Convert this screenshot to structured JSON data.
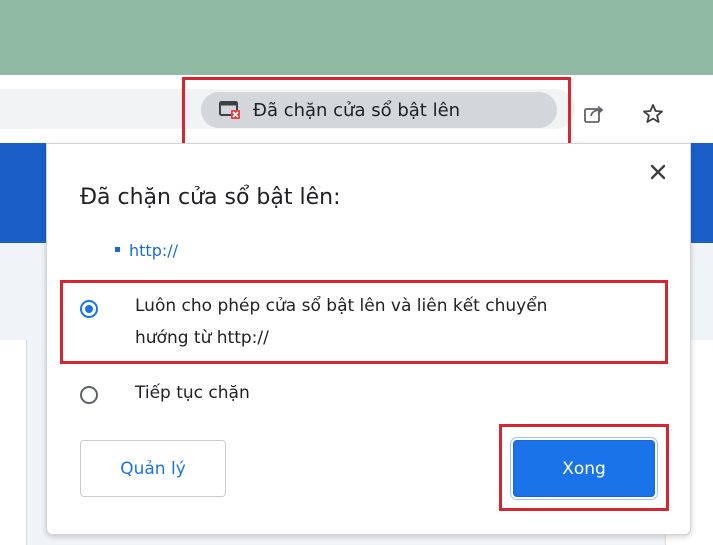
{
  "toolbar": {
    "blocked_chip_label": "Đã chặn cửa sổ bật lên",
    "icons": [
      "popup-blocked-icon",
      "share-icon",
      "bookmark-star-icon"
    ]
  },
  "dialog": {
    "title": "Đã chặn cửa sổ bật lên:",
    "blocked_url": "http://",
    "options": [
      {
        "line1": "Luôn cho phép cửa sổ bật lên và liên kết chuyển",
        "line2": "hướng từ http://",
        "selected": true
      },
      {
        "line1": "Tiếp tục chặn",
        "selected": false
      }
    ],
    "manage_label": "Quản lý",
    "done_label": "Xong"
  },
  "colors": {
    "accent": "#1a73e8",
    "highlight_red": "#d6262f",
    "page_blue": "#1a5fc8",
    "top_strip": "#8fb9a2"
  }
}
